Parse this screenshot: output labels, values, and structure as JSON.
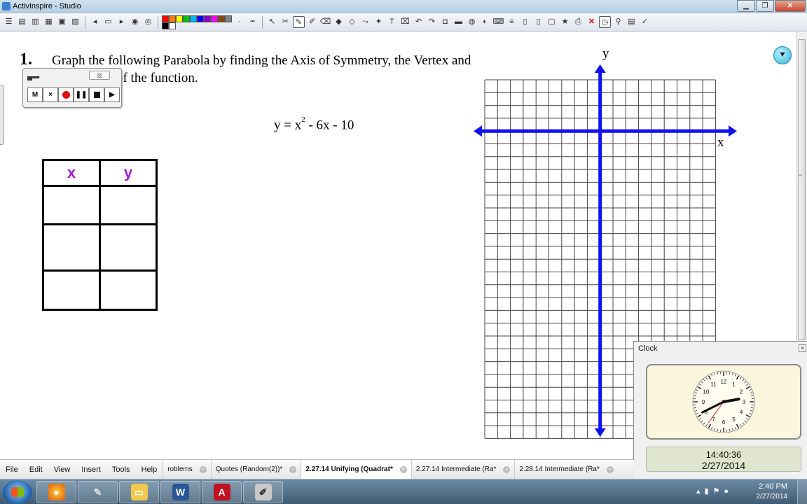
{
  "window": {
    "title": "ActivInspire - Studio"
  },
  "toolbar": {
    "colors": [
      "#ff0000",
      "#ff7f00",
      "#ffff00",
      "#00c000",
      "#00b0f0",
      "#0000ff",
      "#9000c0",
      "#ff00ff",
      "#8b4513",
      "#808080",
      "#000000",
      "#ffffff"
    ]
  },
  "page": {
    "question_number": "1.",
    "question_line1": "Graph the following Parabola by finding the Axis of Symmetry, the Vertex and",
    "question_line2": "the Zeros of the function.",
    "equation_prefix": "y = x",
    "equation_exp": "2",
    "equation_suffix": " - 6x - 10",
    "table": {
      "header_x": "x",
      "header_y": "y"
    },
    "graph": {
      "x_label": "x",
      "y_label": "y"
    }
  },
  "recorder": {
    "m_label": "M",
    "x_label": "×"
  },
  "clock": {
    "title": "Clock",
    "time": "14:40:36",
    "date": "2/27/2014",
    "hour": 14,
    "minute": 40,
    "second": 36
  },
  "menu": [
    "File",
    "Edit",
    "View",
    "Insert",
    "Tools",
    "Help"
  ],
  "tabs": [
    {
      "label": "roblems",
      "active": false
    },
    {
      "label": "Quotes (Random(2))*",
      "active": false
    },
    {
      "label": "2.27.14 Unifying (Quadrat*",
      "active": true
    },
    {
      "label": "2.27.14 Intermediate (Ra*",
      "active": false
    },
    {
      "label": "2.28.14 Intermediate (Ra*",
      "active": false
    }
  ],
  "taskbar": {
    "time": "2:40 PM",
    "date": "2/27/2014"
  }
}
